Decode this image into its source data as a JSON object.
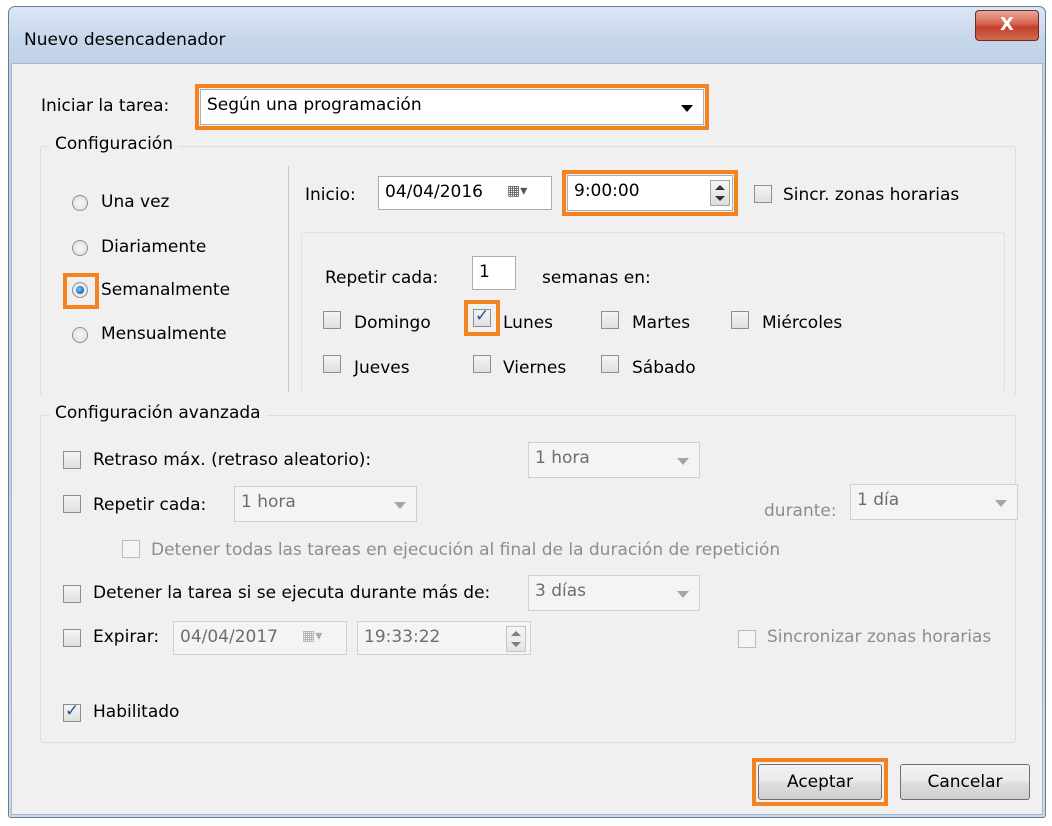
{
  "window": {
    "title": "Nuevo desencadenador",
    "close_label": "X"
  },
  "start_task": {
    "label": "Iniciar la tarea:",
    "value": "Según una programación"
  },
  "config": {
    "title": "Configuración",
    "schedule_options": [
      {
        "label": "Una vez",
        "checked": false
      },
      {
        "label": "Diariamente",
        "checked": false
      },
      {
        "label": "Semanalmente",
        "checked": true
      },
      {
        "label": "Mensualmente",
        "checked": false
      }
    ],
    "start_label": "Inicio:",
    "start_date": "04/04/2016",
    "start_time": "9:00:00",
    "sync_tz_label": "Sincr. zonas horarias",
    "repeat_label": "Repetir cada:",
    "repeat_value": "1",
    "weeks_label": "semanas en:",
    "days": {
      "domingo": "Domingo",
      "lunes": "Lunes",
      "martes": "Martes",
      "miercoles": "Miércoles",
      "jueves": "Jueves",
      "viernes": "Viernes",
      "sabado": "Sábado"
    },
    "lunes_checked": true
  },
  "advanced": {
    "title": "Configuración avanzada",
    "max_delay_label": "Retraso máx. (retraso aleatorio):",
    "max_delay_value": "1 hora",
    "repeat_label": "Repetir cada:",
    "repeat_value": "1 hora",
    "during_label": "durante:",
    "during_value": "1 día",
    "stop_all_label": "Detener todas las tareas en ejecución al final de la duración de repetición",
    "stop_task_label": "Detener la tarea si se ejecuta durante más de:",
    "stop_task_value": "3 días",
    "expire_label": "Expirar:",
    "expire_date": "04/04/2017",
    "expire_time": "19:33:22",
    "sync_tz_label": "Sincronizar zonas horarias",
    "enabled_label": "Habilitado",
    "enabled_checked": true
  },
  "buttons": {
    "ok": "Aceptar",
    "cancel": "Cancelar"
  },
  "colors": {
    "highlight": "#f58220",
    "accent": "#1a64b5"
  }
}
